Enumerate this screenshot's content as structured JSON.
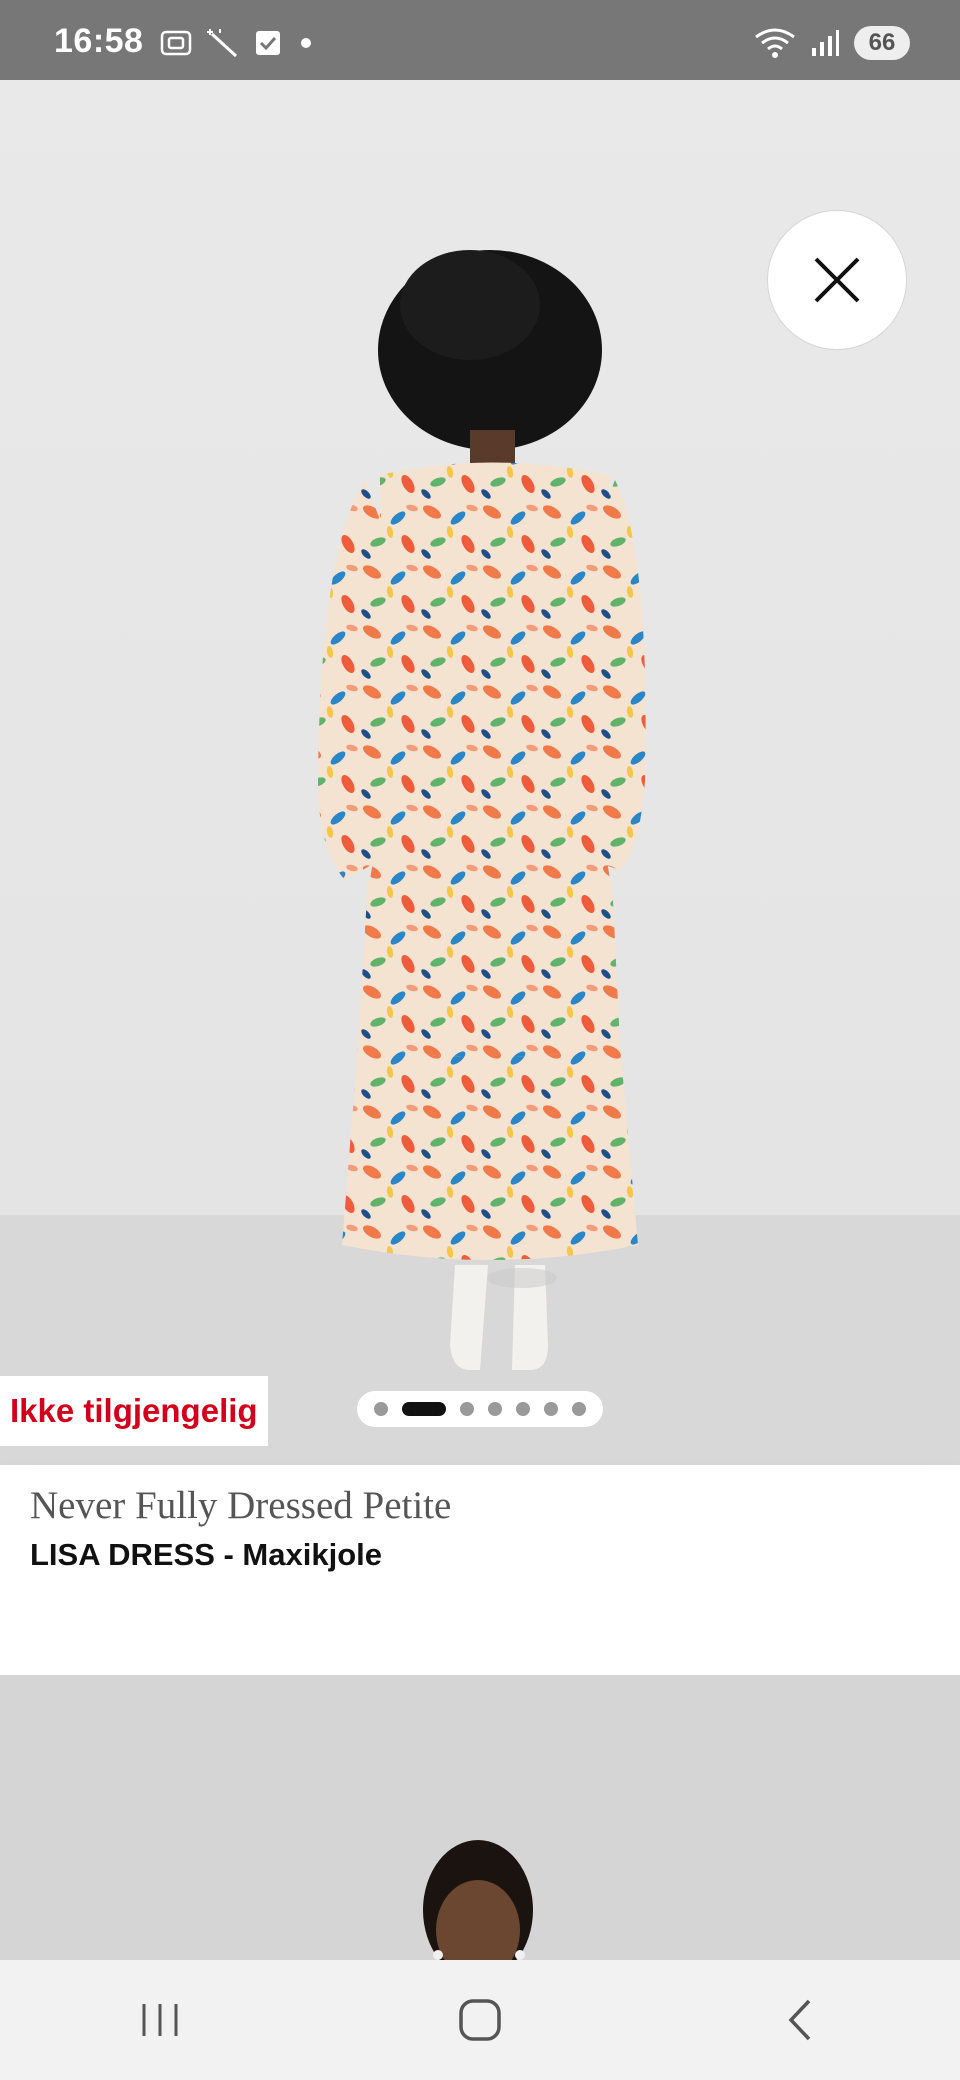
{
  "status_bar": {
    "time": "16:58",
    "battery": "66",
    "left_icons": [
      "screenshot-icon",
      "magic-wand-icon",
      "checkbox-icon",
      "dot-icon"
    ],
    "right_icons": [
      "wifi-icon",
      "signal-icon",
      "battery-icon"
    ]
  },
  "product": {
    "availability_label": "Ikke tilgjengelig",
    "brand": "Never Fully Dressed Petite",
    "name": "LISA DRESS - Maxikjole",
    "image_count": 7,
    "active_image_index": 1
  },
  "colors": {
    "accent_red": "#d3001b",
    "status_bar": "#777777",
    "nav_bar": "#f2f2f2"
  },
  "nav": {
    "items": [
      "recent-apps-icon",
      "home-icon",
      "back-icon"
    ]
  }
}
